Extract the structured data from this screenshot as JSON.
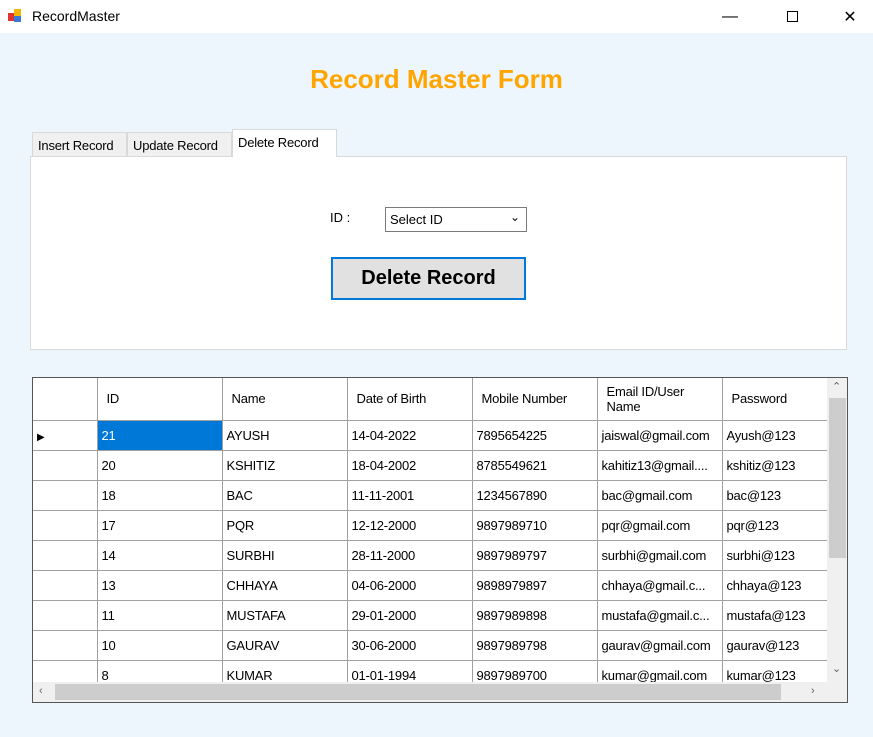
{
  "window": {
    "title": "RecordMaster"
  },
  "form": {
    "title": "Record Master Form"
  },
  "tabs": [
    {
      "label": "Insert Record"
    },
    {
      "label": "Update Record"
    },
    {
      "label": "Delete Record",
      "active": true
    }
  ],
  "delete": {
    "id_label": "ID :",
    "combo_value": "Select ID",
    "button_label": "Delete Record"
  },
  "colors": {
    "title": "#FFA500",
    "selection": "#0078D7",
    "button_border": "#0078D7"
  },
  "grid": {
    "columns": [
      "ID",
      "Name",
      "Date of Birth",
      "Mobile Number",
      "Email ID/User Name",
      "Password"
    ],
    "rows": [
      [
        "21",
        "AYUSH",
        "14-04-2022",
        "7895654225",
        "jaiswal@gmail.com",
        "Ayush@123"
      ],
      [
        "20",
        "KSHITIZ",
        "18-04-2002",
        "8785549621",
        "kahitiz13@gmail....",
        "kshitiz@123"
      ],
      [
        "18",
        "BAC",
        "11-11-2001",
        "1234567890",
        "bac@gmail.com",
        "bac@123"
      ],
      [
        "17",
        "PQR",
        "12-12-2000",
        "9897989710",
        "pqr@gmail.com",
        "pqr@123"
      ],
      [
        "14",
        "SURBHI",
        "28-11-2000",
        "9897989797",
        "surbhi@gmail.com",
        "surbhi@123"
      ],
      [
        "13",
        "CHHAYA",
        "04-06-2000",
        "9898979897",
        "chhaya@gmail.c...",
        "chhaya@123"
      ],
      [
        "11",
        "MUSTAFA",
        "29-01-2000",
        "9897989898",
        "mustafa@gmail.c...",
        "mustafa@123"
      ],
      [
        "10",
        "GAURAV",
        "30-06-2000",
        "9897989798",
        "gaurav@gmail.com",
        "gaurav@123"
      ],
      [
        "8",
        "KUMAR",
        "01-01-1994",
        "9897989700",
        "kumar@gmail.com",
        "kumar@123"
      ]
    ],
    "selected_row": 0
  }
}
